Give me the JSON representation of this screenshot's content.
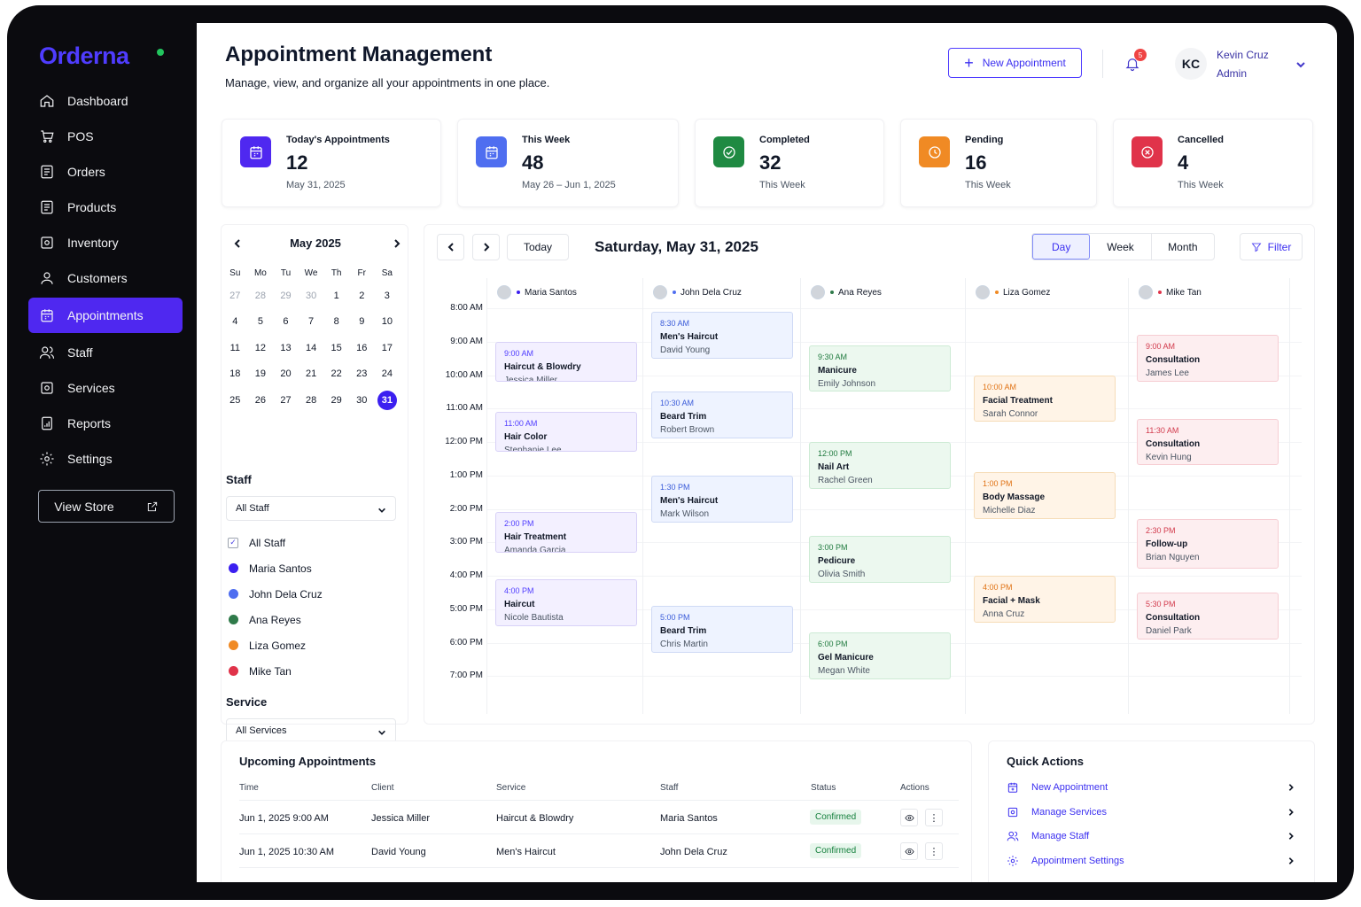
{
  "brand": {
    "name": "Orderna",
    "status_color": "#22c55e",
    "accent": "#4f28f0"
  },
  "sidebar": {
    "items": [
      {
        "label": "Dashboard",
        "icon": "home-icon"
      },
      {
        "label": "POS",
        "icon": "cart-icon"
      },
      {
        "label": "Orders",
        "icon": "list-icon"
      },
      {
        "label": "Products",
        "icon": "list-icon"
      },
      {
        "label": "Inventory",
        "icon": "box-icon"
      },
      {
        "label": "Customers",
        "icon": "user-icon"
      },
      {
        "label": "Appointments",
        "icon": "calendar-icon",
        "active": true
      },
      {
        "label": "Staff",
        "icon": "users-icon"
      },
      {
        "label": "Services",
        "icon": "gear-box-icon"
      },
      {
        "label": "Reports",
        "icon": "report-icon"
      },
      {
        "label": "Settings",
        "icon": "gear-icon"
      }
    ],
    "view_store": "View Store"
  },
  "header": {
    "title": "Appointment Management",
    "subtitle": "Manage, view, and organize all your appointments in one place.",
    "new_button": "New Appointment",
    "notifications": "5",
    "avatar_initials": "KC",
    "user_name": "Kevin Cruz",
    "user_role": "Admin"
  },
  "stats": [
    {
      "label": "Today's Appointments",
      "value": "12",
      "sub": "May 31, 2025",
      "color": "#4f28f0",
      "icon": "calendar-icon"
    },
    {
      "label": "This Week",
      "value": "48",
      "sub": "May 26 – Jun 1, 2025",
      "color": "#4f6ef0",
      "icon": "calendar-icon"
    },
    {
      "label": "Completed",
      "value": "32",
      "sub": "This Week",
      "color": "#1f8a42",
      "icon": "check-circle-icon"
    },
    {
      "label": "Pending",
      "value": "16",
      "sub": "This Week",
      "color": "#f08a24",
      "icon": "clock-icon"
    },
    {
      "label": "Cancelled",
      "value": "4",
      "sub": "This Week",
      "color": "#e0334a",
      "icon": "x-circle-icon"
    }
  ],
  "mini_calendar": {
    "month": "May 2025",
    "dow": [
      "Su",
      "Mo",
      "Tu",
      "We",
      "Th",
      "Fr",
      "Sa"
    ],
    "weeks": [
      [
        "27",
        "28",
        "29",
        "30",
        "1",
        "2",
        "3"
      ],
      [
        "4",
        "5",
        "6",
        "7",
        "8",
        "9",
        "10"
      ],
      [
        "11",
        "12",
        "13",
        "14",
        "15",
        "16",
        "17"
      ],
      [
        "18",
        "19",
        "20",
        "21",
        "22",
        "23",
        "24"
      ],
      [
        "25",
        "26",
        "27",
        "28",
        "29",
        "30",
        "31"
      ]
    ],
    "muted_first_row": 4,
    "selected": "31"
  },
  "filters": {
    "staff_title": "Staff",
    "staff_select": "All Staff",
    "staff_options": [
      {
        "label": "All Staff",
        "type": "check"
      },
      {
        "label": "Maria Santos",
        "color": "#3b1ff0"
      },
      {
        "label": "John Dela Cruz",
        "color": "#4f6ef0"
      },
      {
        "label": "Ana Reyes",
        "color": "#2f7a4a"
      },
      {
        "label": "Liza Gomez",
        "color": "#f08a24"
      },
      {
        "label": "Mike Tan",
        "color": "#e0334a"
      }
    ],
    "service_title": "Service",
    "service_select": "All Services"
  },
  "calendar": {
    "today": "Today",
    "date": "Saturday, May 31, 2025",
    "views": [
      "Day",
      "Week",
      "Month"
    ],
    "active_view": "Day",
    "filter": "Filter",
    "times": [
      "8:00 AM",
      "9:00 AM",
      "10:00 AM",
      "11:00 AM",
      "12:00 PM",
      "1:00 PM",
      "2:00 PM",
      "3:00 PM",
      "4:00 PM",
      "5:00 PM",
      "6:00 PM",
      "7:00 PM"
    ],
    "staff": [
      {
        "name": "Maria Santos",
        "color": "#3b1ff0"
      },
      {
        "name": "John Dela Cruz",
        "color": "#4f6ef0"
      },
      {
        "name": "Ana Reyes",
        "color": "#2f7a4a"
      },
      {
        "name": "Liza Gomez",
        "color": "#f08a24"
      },
      {
        "name": "Mike Tan",
        "color": "#e0334a"
      }
    ],
    "appointments": [
      {
        "col": 0,
        "start": 9.0,
        "end": 10.2,
        "time": "9:00 AM",
        "service": "Haircut & Blowdry",
        "client": "Jessica Miller",
        "tone": "purple"
      },
      {
        "col": 0,
        "start": 11.1,
        "end": 12.3,
        "time": "11:00 AM",
        "service": "Hair Color",
        "client": "Stephanie Lee",
        "tone": "purple"
      },
      {
        "col": 0,
        "start": 14.1,
        "end": 15.3,
        "time": "2:00 PM",
        "service": "Hair Treatment",
        "client": "Amanda Garcia",
        "tone": "purple"
      },
      {
        "col": 0,
        "start": 16.1,
        "end": 17.5,
        "time": "4:00 PM",
        "service": "Haircut",
        "client": "Nicole Bautista",
        "tone": "purple"
      },
      {
        "col": 1,
        "start": 8.1,
        "end": 9.5,
        "time": "8:30 AM",
        "service": "Men's Haircut",
        "client": "David Young",
        "tone": "blue"
      },
      {
        "col": 1,
        "start": 10.5,
        "end": 11.9,
        "time": "10:30 AM",
        "service": "Beard Trim",
        "client": "Robert Brown",
        "tone": "blue"
      },
      {
        "col": 1,
        "start": 13.0,
        "end": 14.4,
        "time": "1:30 PM",
        "service": "Men's Haircut",
        "client": "Mark Wilson",
        "tone": "blue"
      },
      {
        "col": 1,
        "start": 16.9,
        "end": 18.3,
        "time": "5:00 PM",
        "service": "Beard Trim",
        "client": "Chris Martin",
        "tone": "blue"
      },
      {
        "col": 2,
        "start": 9.1,
        "end": 10.5,
        "time": "9:30 AM",
        "service": "Manicure",
        "client": "Emily Johnson",
        "tone": "green"
      },
      {
        "col": 2,
        "start": 12.0,
        "end": 13.4,
        "time": "12:00 PM",
        "service": "Nail Art",
        "client": "Rachel Green",
        "tone": "green"
      },
      {
        "col": 2,
        "start": 14.8,
        "end": 16.2,
        "time": "3:00 PM",
        "service": "Pedicure",
        "client": "Olivia Smith",
        "tone": "green"
      },
      {
        "col": 2,
        "start": 17.7,
        "end": 19.1,
        "time": "6:00 PM",
        "service": "Gel Manicure",
        "client": "Megan White",
        "tone": "green"
      },
      {
        "col": 3,
        "start": 10.0,
        "end": 11.4,
        "time": "10:00 AM",
        "service": "Facial Treatment",
        "client": "Sarah Connor",
        "tone": "orange"
      },
      {
        "col": 3,
        "start": 12.9,
        "end": 14.3,
        "time": "1:00 PM",
        "service": "Body Massage",
        "client": "Michelle Diaz",
        "tone": "orange"
      },
      {
        "col": 3,
        "start": 16.0,
        "end": 17.4,
        "time": "4:00 PM",
        "service": "Facial + Mask",
        "client": "Anna Cruz",
        "tone": "orange"
      },
      {
        "col": 4,
        "start": 8.8,
        "end": 10.2,
        "time": "9:00 AM",
        "service": "Consultation",
        "client": "James Lee",
        "tone": "red"
      },
      {
        "col": 4,
        "start": 11.3,
        "end": 12.7,
        "time": "11:30 AM",
        "service": "Consultation",
        "client": "Kevin Hung",
        "tone": "red"
      },
      {
        "col": 4,
        "start": 14.3,
        "end": 15.8,
        "time": "2:30 PM",
        "service": "Follow-up",
        "client": "Brian Nguyen",
        "tone": "red"
      },
      {
        "col": 4,
        "start": 16.5,
        "end": 17.9,
        "time": "5:30 PM",
        "service": "Consultation",
        "client": "Daniel Park",
        "tone": "red"
      }
    ]
  },
  "upcoming": {
    "title": "Upcoming Appointments",
    "headers": [
      "Time",
      "Client",
      "Service",
      "Staff",
      "Status",
      "Actions"
    ],
    "rows": [
      {
        "time": "Jun 1, 2025  9:00 AM",
        "client": "Jessica Miller",
        "service": "Haircut & Blowdry",
        "staff": "Maria Santos",
        "status": "Confirmed"
      },
      {
        "time": "Jun 1, 2025  10:30 AM",
        "client": "David Young",
        "service": "Men's Haircut",
        "staff": "John Dela Cruz",
        "status": "Confirmed"
      }
    ]
  },
  "quick_actions": {
    "title": "Quick Actions",
    "items": [
      {
        "label": "New Appointment",
        "icon": "calendar-plus-icon"
      },
      {
        "label": "Manage Services",
        "icon": "gear-box-icon"
      },
      {
        "label": "Manage Staff",
        "icon": "users-icon"
      },
      {
        "label": "Appointment Settings",
        "icon": "gear-icon"
      }
    ]
  }
}
